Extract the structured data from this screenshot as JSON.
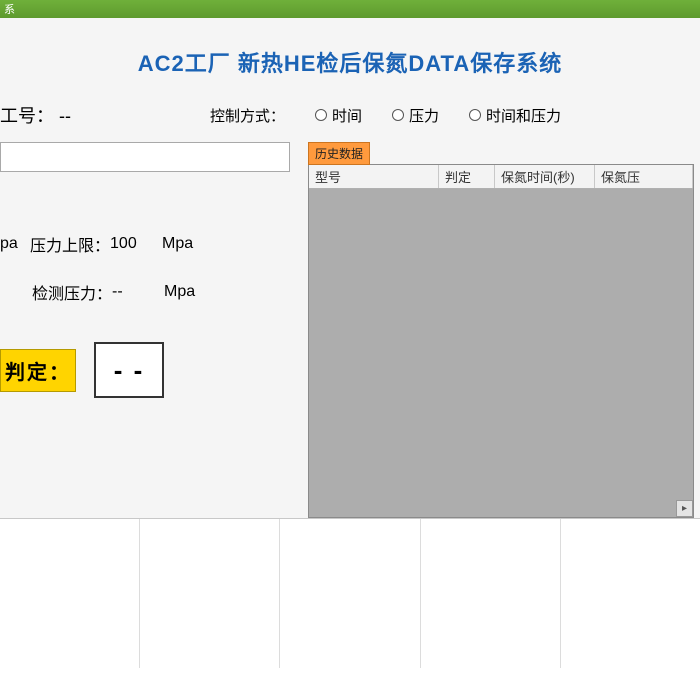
{
  "window": {
    "titlebar_suffix": "系"
  },
  "header": {
    "title": "AC2工厂 新热HE检后保氮DATA保存系统"
  },
  "fields": {
    "employee_label": "工号：",
    "employee_value": "--",
    "control_method_label": "控制方式：",
    "radio_time": "时间",
    "radio_pressure": "压力",
    "radio_both": "时间和压力"
  },
  "input": {
    "value": ""
  },
  "spec": {
    "unit_left_trunc": "pa",
    "upper_label": "压力上限：",
    "upper_value": "100",
    "upper_unit": "Mpa",
    "detect_label": "检测压力：",
    "detect_value": "--",
    "detect_unit": "Mpa"
  },
  "judge": {
    "label": "判定：",
    "value": "- -"
  },
  "history": {
    "tab_label": "历史数据",
    "columns": {
      "model": "型号",
      "judge": "判定",
      "time": "保氮时间(秒)",
      "pressure": "保氮压"
    }
  }
}
